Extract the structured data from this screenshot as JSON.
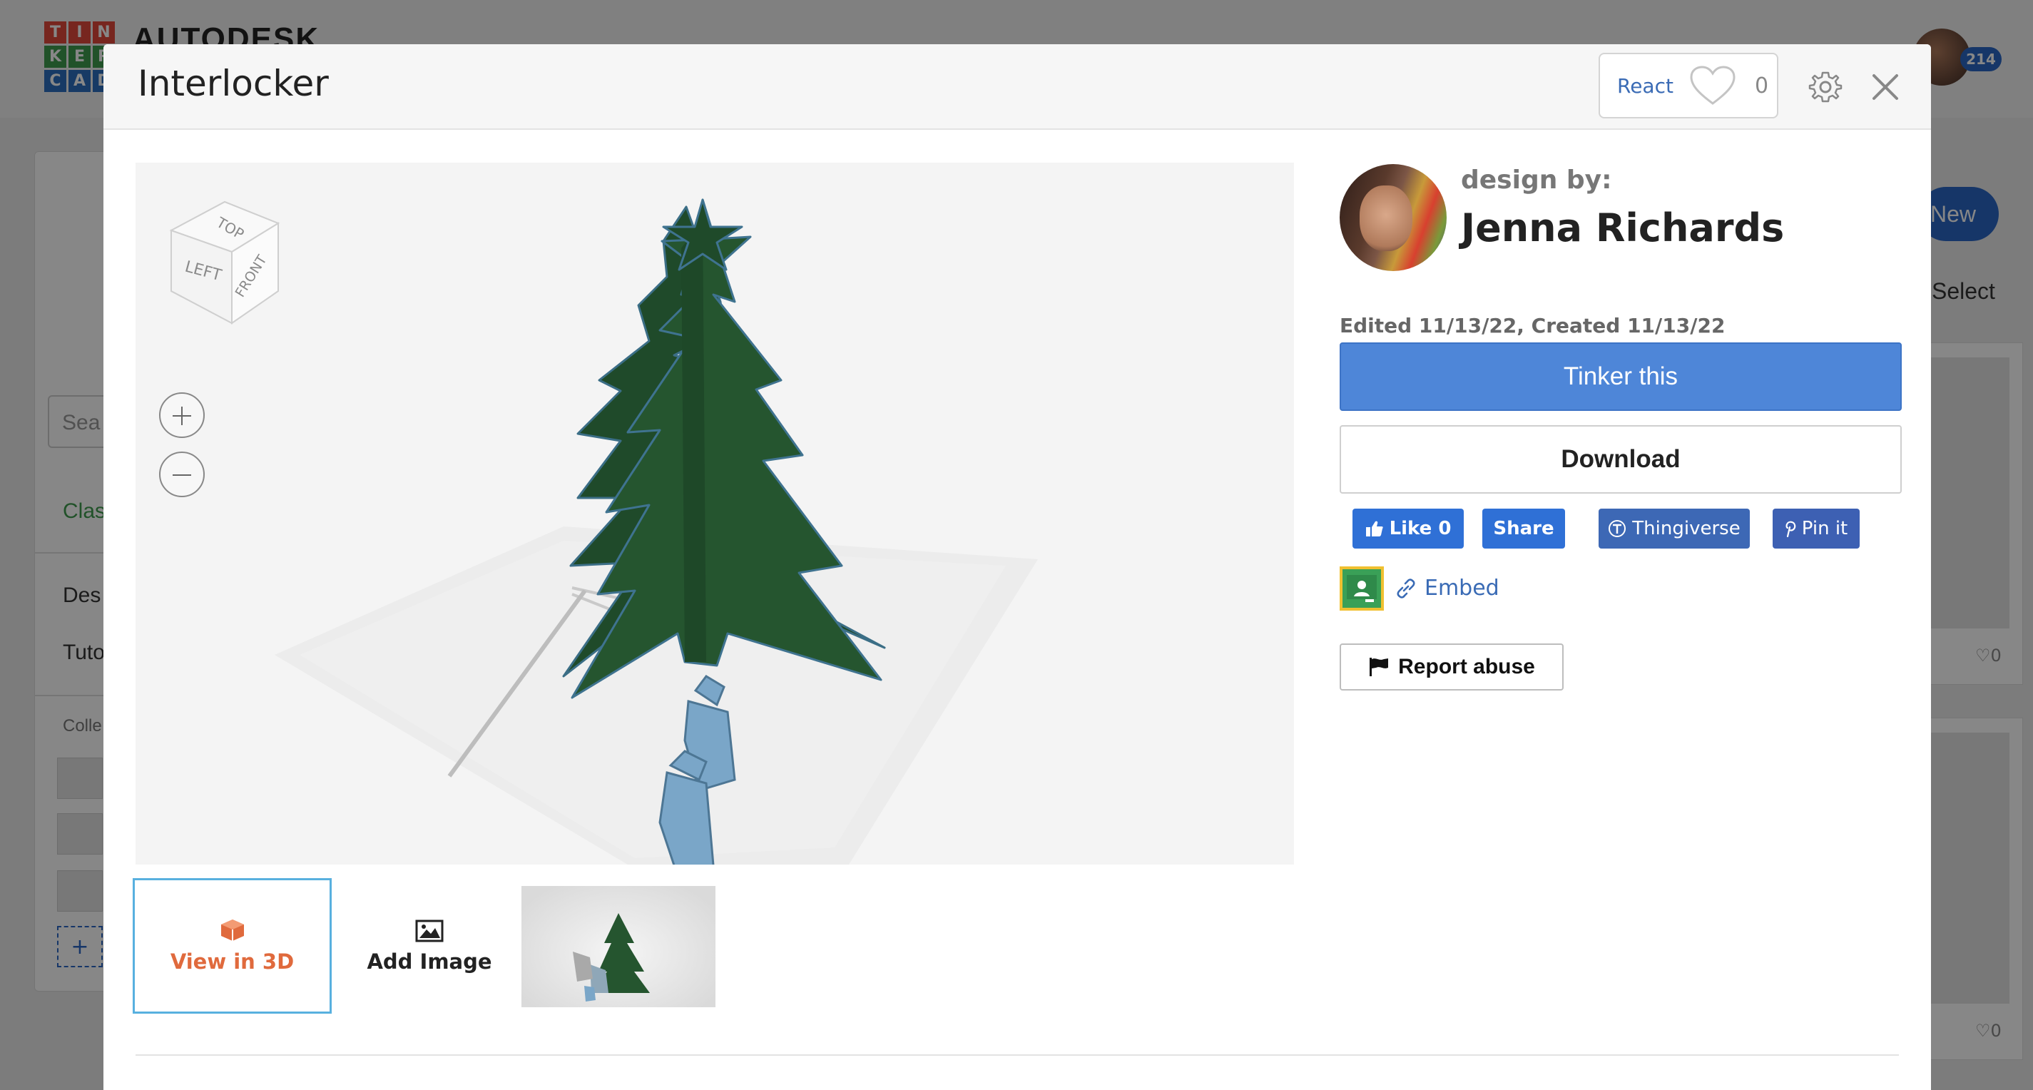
{
  "background": {
    "logo_letters": [
      "T",
      "I",
      "N",
      "K",
      "E",
      "R",
      "C",
      "A",
      "D"
    ],
    "logo_colors": [
      "#e0493b",
      "#e0493b",
      "#e0493b",
      "#3f9b4f",
      "#3f9b4f",
      "#3f9b4f",
      "#2c6fbf",
      "#2c6fbf",
      "#2c6fbf"
    ],
    "brand": "AUTODESK",
    "notification_count": "214",
    "search_placeholder": "Sea",
    "sidebar_items": [
      "Clas",
      "Des",
      "Tuto",
      "Colle"
    ],
    "new_button": "New",
    "select_label": "Select",
    "card_likes": [
      "♡0",
      "♡0"
    ]
  },
  "modal": {
    "title": "Interlocker",
    "react": {
      "label": "React",
      "count": "0"
    }
  },
  "viewer": {
    "cube_faces": {
      "top": "TOP",
      "left": "LEFT",
      "front": "FRONT"
    },
    "tree_color": "#24532f",
    "gift_color": "#7aa6c8"
  },
  "thumbnails": {
    "view3d_label": "View in 3D",
    "add_image_label": "Add Image"
  },
  "author": {
    "design_by": "design by:",
    "name": "Jenna Richards",
    "dates": "Edited 11/13/22, Created 11/13/22"
  },
  "actions": {
    "tinker": "Tinker this",
    "download": "Download",
    "like": "Like 0",
    "share": "Share",
    "thingiverse": "Thingiverse",
    "pin": "Pin it",
    "embed": "Embed",
    "report": "Report abuse"
  },
  "colors": {
    "primary": "#4e86d8",
    "link": "#3a6bb5",
    "accent_orange": "#e06a3d",
    "selected_border": "#58b0df"
  }
}
